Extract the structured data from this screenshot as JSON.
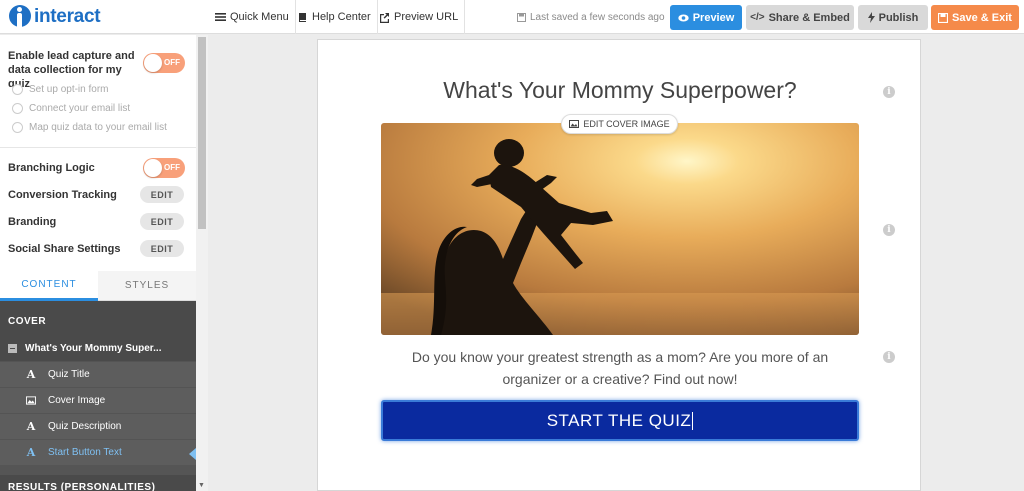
{
  "topbar": {
    "logo_text": "interact",
    "quick_menu": "Quick Menu",
    "help_center": "Help Center",
    "preview_url": "Preview URL",
    "saved_status": "Last saved a few seconds ago",
    "preview_btn": "Preview",
    "share_btn": "Share & Embed",
    "publish_btn": "Publish",
    "save_exit_btn": "Save & Exit"
  },
  "settings": {
    "lead_capture_label": "Enable lead capture and data collection for my quiz",
    "lead_toggle": "OFF",
    "lead_options": [
      "Set up opt-in form",
      "Connect your email list",
      "Map quiz data to your email list"
    ],
    "branching_label": "Branching Logic",
    "branching_toggle": "OFF",
    "conversion_label": "Conversion Tracking",
    "branding_label": "Branding",
    "social_label": "Social Share Settings",
    "edit_label": "EDIT"
  },
  "tabs": {
    "content": "CONTENT",
    "styles": "STYLES"
  },
  "tree": {
    "cover": "COVER",
    "quiz_node": "What's Your Mommy Super...",
    "items": [
      {
        "label": "Quiz Title",
        "icon": "text-icon"
      },
      {
        "label": "Cover Image",
        "icon": "image-icon"
      },
      {
        "label": "Quiz Description",
        "icon": "text-icon"
      },
      {
        "label": "Start Button Text",
        "icon": "text-icon"
      }
    ],
    "results": "RESULTS (PERSONALITIES)"
  },
  "canvas": {
    "title": "What's Your Mommy Superpower?",
    "edit_cover": "EDIT COVER IMAGE",
    "description": "Do you know your greatest strength as a mom? Are you more of an organizer or a creative? Find out now!",
    "start_button": "START THE QUIZ"
  },
  "colors": {
    "brand_blue": "#1e6fc4",
    "preview": "#2b8ee0",
    "save": "#f58a4a",
    "start_button": "#0a2a9f"
  }
}
